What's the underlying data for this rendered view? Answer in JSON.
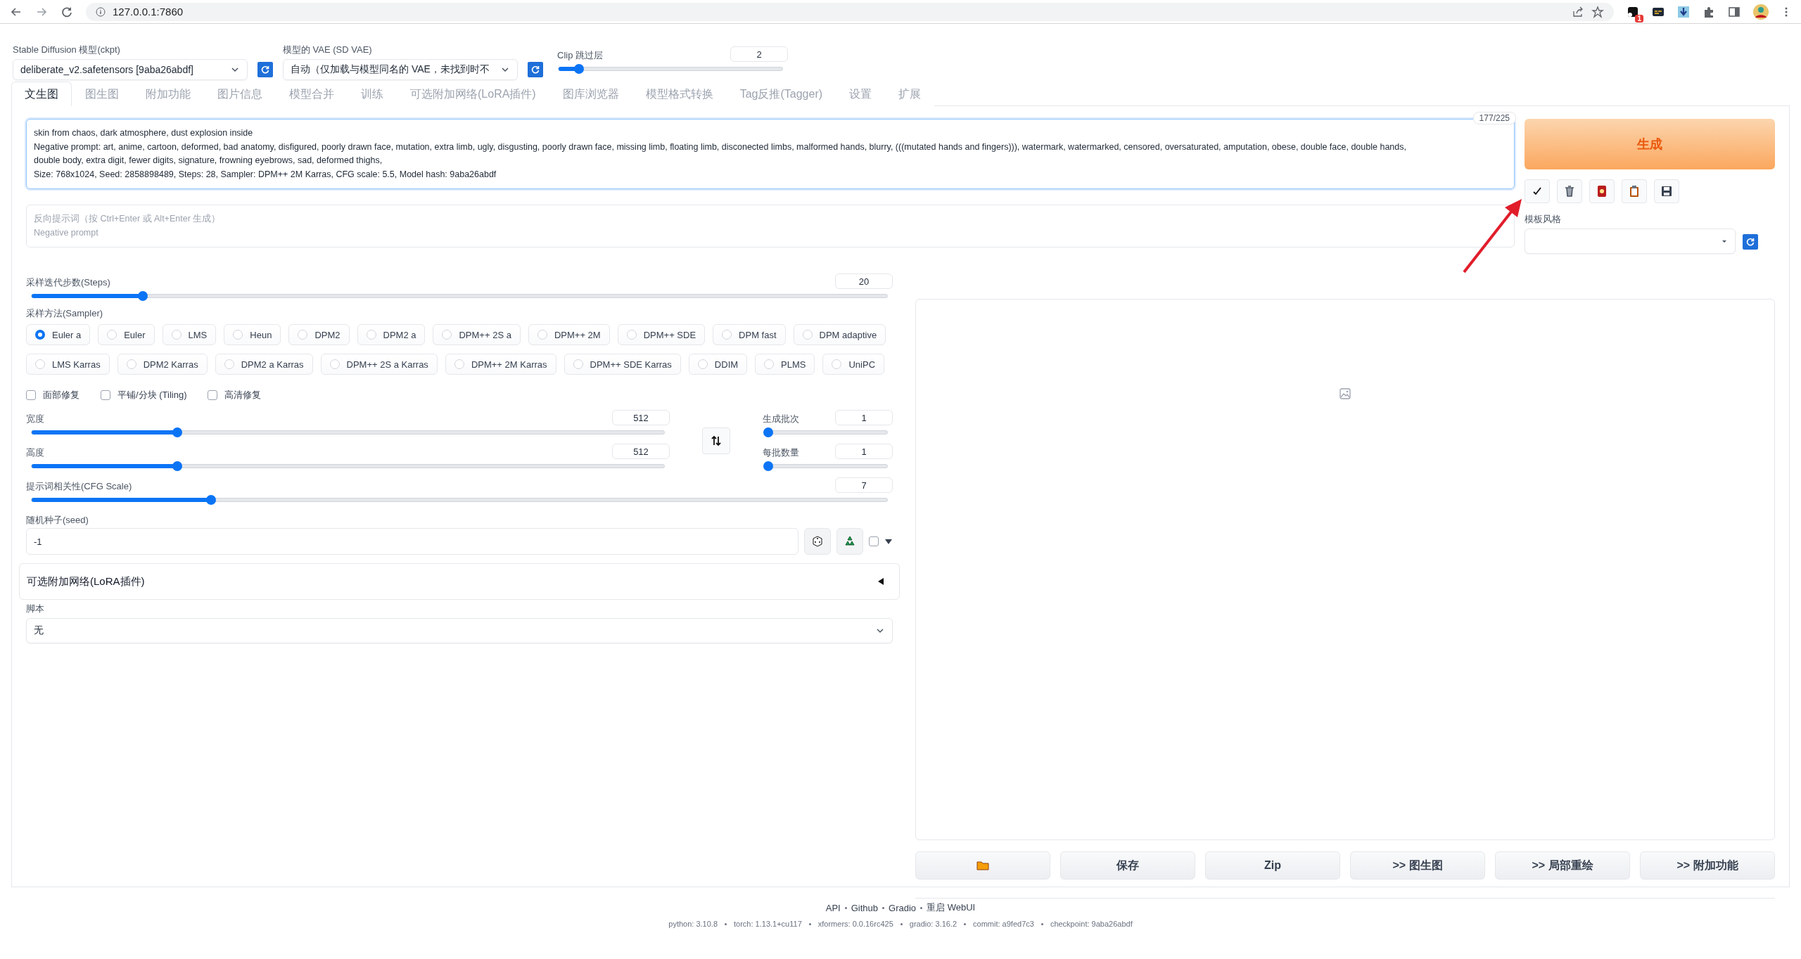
{
  "browser": {
    "url": "127.0.0.1:7860",
    "extension_badge": "1"
  },
  "model": {
    "label": "Stable Diffusion 模型(ckpt)",
    "value": "deliberate_v2.safetensors [9aba26abdf]"
  },
  "vae": {
    "label": "模型的 VAE (SD VAE)",
    "value": "自动（仅加载与模型同名的 VAE，未找到时不"
  },
  "clip_skip": {
    "label": "Clip 跳过层",
    "value": "2",
    "level": 0.09
  },
  "tabs": [
    {
      "label": "文生图",
      "selected": true
    },
    {
      "label": "图生图",
      "selected": false
    },
    {
      "label": "附加功能",
      "selected": false
    },
    {
      "label": "图片信息",
      "selected": false
    },
    {
      "label": "模型合并",
      "selected": false
    },
    {
      "label": "训练",
      "selected": false
    },
    {
      "label": "可选附加网络(LoRA插件)",
      "selected": false
    },
    {
      "label": "图库浏览器",
      "selected": false
    },
    {
      "label": "模型格式转换",
      "selected": false
    },
    {
      "label": "Tag反推(Tagger)",
      "selected": false
    },
    {
      "label": "设置",
      "selected": false
    },
    {
      "label": "扩展",
      "selected": false
    }
  ],
  "prompt": {
    "value": "skin from chaos, dark atmosphere, dust explosion inside\nNegative prompt: art, anime, cartoon, deformed, bad anatomy, disfigured, poorly drawn face, mutation, extra limb, ugly, disgusting, poorly drawn face, missing limb, floating limb, disconected limbs, malformed hands, blurry, (((mutated hands and fingers))), watermark, watermarked, censored, oversaturated, amputation, obese, double face, double hands,\ndouble body, extra digit, fewer digits, signature, frowning eyebrows, sad, deformed thighs,\nSize: 768x1024, Seed: 2858898489, Steps: 28, Sampler: DPM++ 2M Karras, CFG scale: 5.5, Model hash: 9aba26abdf",
    "counter": "177/225"
  },
  "negative_prompt": {
    "placeholder": "反向提示词（按 Ctrl+Enter 或 Alt+Enter 生成）\nNegative prompt"
  },
  "generate": {
    "label": "生成"
  },
  "style": {
    "label": "模板风格"
  },
  "steps": {
    "label": "采样迭代步数(Steps)",
    "value": "20",
    "level": 0.13
  },
  "sampler": {
    "label": "采样方法(Sampler)",
    "options": [
      {
        "label": "Euler a",
        "selected": true
      },
      {
        "label": "Euler",
        "selected": false
      },
      {
        "label": "LMS",
        "selected": false
      },
      {
        "label": "Heun",
        "selected": false
      },
      {
        "label": "DPM2",
        "selected": false
      },
      {
        "label": "DPM2 a",
        "selected": false
      },
      {
        "label": "DPM++ 2S a",
        "selected": false
      },
      {
        "label": "DPM++ 2M",
        "selected": false
      },
      {
        "label": "DPM++ SDE",
        "selected": false
      },
      {
        "label": "DPM fast",
        "selected": false
      },
      {
        "label": "DPM adaptive",
        "selected": false
      },
      {
        "label": "LMS Karras",
        "selected": false
      },
      {
        "label": "DPM2 Karras",
        "selected": false
      },
      {
        "label": "DPM2 a Karras",
        "selected": false
      },
      {
        "label": "DPM++ 2S a Karras",
        "selected": false
      },
      {
        "label": "DPM++ 2M Karras",
        "selected": false
      },
      {
        "label": "DPM++ SDE Karras",
        "selected": false
      },
      {
        "label": "DDIM",
        "selected": false
      },
      {
        "label": "PLMS",
        "selected": false
      },
      {
        "label": "UniPC",
        "selected": false
      }
    ]
  },
  "options": [
    {
      "label": "面部修复",
      "checked": false
    },
    {
      "label": "平铺/分块 (Tiling)",
      "checked": false
    },
    {
      "label": "高清修复",
      "checked": false
    }
  ],
  "width": {
    "label": "宽度",
    "value": "512",
    "level": 0.23
  },
  "height": {
    "label": "高度",
    "value": "512",
    "level": 0.23
  },
  "batch_count": {
    "label": "生成批次",
    "value": "1",
    "level": 0
  },
  "batch_size": {
    "label": "每批数量",
    "value": "1",
    "level": 0
  },
  "cfg": {
    "label": "提示词相关性(CFG Scale)",
    "value": "7",
    "level": 0.21
  },
  "seed": {
    "label": "随机种子(seed)",
    "value": "-1",
    "extra": false
  },
  "lora": {
    "title": "可选附加网络(LoRA插件)",
    "expanded": false
  },
  "script": {
    "label": "脚本",
    "value": "无"
  },
  "output_buttons": [
    {
      "kind": "folder"
    },
    {
      "kind": "text",
      "label": "保存"
    },
    {
      "kind": "text",
      "label": "Zip"
    },
    {
      "kind": "text",
      "label": ">> 图生图"
    },
    {
      "kind": "text",
      "label": ">> 局部重绘"
    },
    {
      "kind": "text",
      "label": ">> 附加功能"
    }
  ],
  "footer": {
    "links": [
      "API",
      "Github",
      "Gradio",
      "重启 WebUI"
    ],
    "versions": [
      "python: 3.10.8",
      "torch: 1.13.1+cu117",
      "xformers: 0.0.16rc425",
      "gradio: 3.16.2",
      "commit: a9fed7c3",
      "checkpoint: 9aba26abdf"
    ]
  }
}
